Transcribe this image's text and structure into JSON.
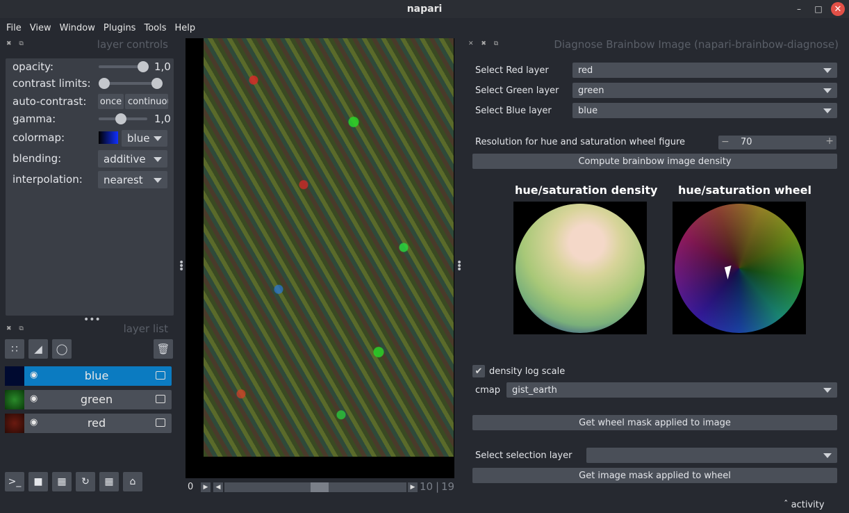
{
  "window": {
    "title": "napari"
  },
  "menu": [
    "File",
    "View",
    "Window",
    "Plugins",
    "Tools",
    "Help"
  ],
  "layer_controls": {
    "title": "layer controls",
    "opacity_label": "opacity:",
    "opacity_value": "1,0",
    "contrast_label": "contrast limits:",
    "autocontrast_label": "auto-contrast:",
    "once_label": "once",
    "continuous_label": "continuous",
    "gamma_label": "gamma:",
    "gamma_value": "1,0",
    "colormap_label": "colormap:",
    "colormap_value": "blue",
    "blending_label": "blending:",
    "blending_value": "additive",
    "interpolation_label": "interpolation:",
    "interpolation_value": "nearest"
  },
  "layer_list": {
    "title": "layer list",
    "layers": [
      {
        "name": "blue",
        "selected": true,
        "color": "#0b7bc1"
      },
      {
        "name": "green",
        "selected": false
      },
      {
        "name": "red",
        "selected": false
      }
    ]
  },
  "dims": {
    "start": "0",
    "current": "10",
    "total": "19"
  },
  "plugin": {
    "title": "Diagnose Brainbow Image (napari-brainbow-diagnose)",
    "red_label": "Select Red layer",
    "red_value": "red",
    "green_label": "Select Green layer",
    "green_value": "green",
    "blue_label": "Select Blue layer",
    "blue_value": "blue",
    "resolution_label": "Resolution for hue and saturation wheel figure",
    "resolution_value": "70",
    "compute_button": "Compute brainbow image density",
    "density_title": "hue/saturation density",
    "wheel_title": "hue/saturation wheel",
    "log_scale_label": "density log scale",
    "log_scale_checked": true,
    "cmap_label": "cmap",
    "cmap_value": "gist_earth",
    "wheel_mask_button": "Get wheel mask applied to image",
    "selection_label": "Select selection layer",
    "selection_value": "",
    "image_mask_button": "Get image mask applied to wheel"
  },
  "activity": "activity"
}
